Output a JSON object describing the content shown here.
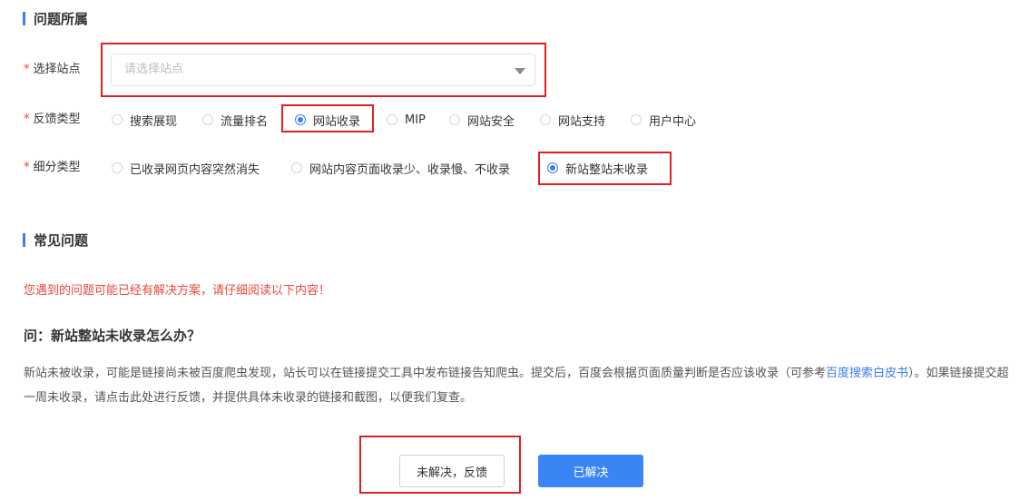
{
  "section_problem": {
    "title": "问题所属"
  },
  "site_select": {
    "label": "选择站点",
    "required_mark": "*",
    "placeholder": "请选择站点"
  },
  "feedback_type": {
    "label": "反馈类型",
    "required_mark": "*",
    "options": [
      "搜索展现",
      "流量排名",
      "网站收录",
      "MIP",
      "网站安全",
      "网站支持",
      "用户中心"
    ],
    "selected": "网站收录"
  },
  "sub_type": {
    "label": "细分类型",
    "required_mark": "*",
    "options": [
      "已收录网页内容突然消失",
      "网站内容页面收录少、收录慢、不收录",
      "新站整站未收录"
    ],
    "selected": "新站整站未收录"
  },
  "section_faq": {
    "title": "常见问题"
  },
  "notice": "您遇到的问题可能已经有解决方案，请仔细阅读以下内容！",
  "faq": {
    "question": "问：新站整站未收录怎么办？",
    "answer_part1": "新站未被收录，可能是链接尚未被百度爬虫发现，站长可以在链接提交工具中发布链接告知爬虫。提交后，百度会根据页面质量判断是否应该收录（可参考",
    "answer_link": "百度搜索白皮书",
    "answer_part2": "）。如果链接提交超一周未收录，请点击此处进行反馈，并提供具体未收录的链接和截图，以便我们复查。"
  },
  "buttons": {
    "unresolved": "未解决，反馈",
    "resolved": "已解决"
  },
  "colors": {
    "accent": "#3a7ef0",
    "required": "#f0412e",
    "notice": "#e8473b",
    "highlight_box": "#e02121"
  }
}
